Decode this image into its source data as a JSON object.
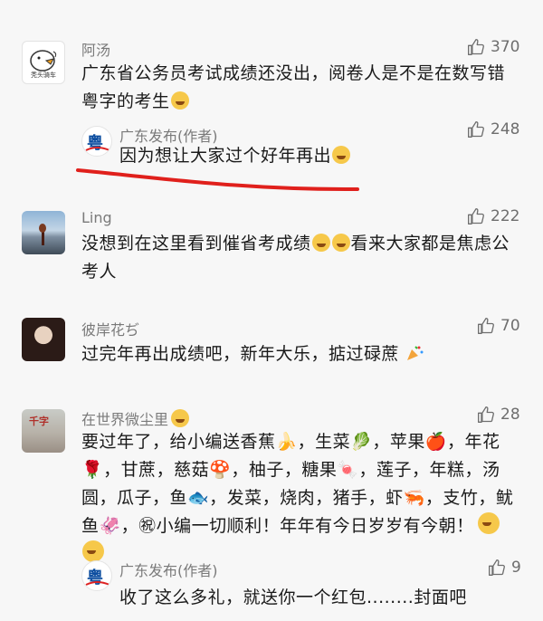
{
  "comments": [
    {
      "author": "阿汤",
      "avatar_caption": "秃头骑车",
      "likes": "370",
      "text": "广东省公务员考试成绩还没出，阅卷人是不是在数写错粤字的考生",
      "reply": {
        "author": "广东发布(作者)",
        "likes": "248",
        "text": "因为想让大家过个好年再出"
      }
    },
    {
      "author": "Ling",
      "likes": "222",
      "text_a": "没想到在这里看到催省考成绩",
      "text_b": "看来大家都是焦虑公考人"
    },
    {
      "author": "彼岸花ぢ",
      "likes": "70",
      "text": "过完年再出成绩吧，新年大乐，掂过碌蔗"
    },
    {
      "author": "在世界微尘里",
      "avatar_stamp": "千字",
      "likes": "28",
      "text": "要过年了，给小编送香蕉🍌，生菜🥬，苹果🍎，年花🌹，甘蔗，慈菇🍄，柚子，糖果🍬，莲子，年糕，汤圆，瓜子，鱼🐟，发菜，烧肉，猪手，虾🦐，支竹，鱿鱼🦑，㊗小编一切顺利！年年有今日岁岁有今朝！",
      "reply": {
        "author": "广东发布(作者)",
        "likes": "9",
        "text": "收了这么多礼，就送你一个红包........封面吧"
      }
    }
  ],
  "colors": {
    "annotation_line": "#e0201c",
    "name": "#7a7a7a",
    "text": "#1a1a1a",
    "background": "#f7f7f7"
  },
  "icons": {
    "like": "thumbs-up-icon"
  }
}
